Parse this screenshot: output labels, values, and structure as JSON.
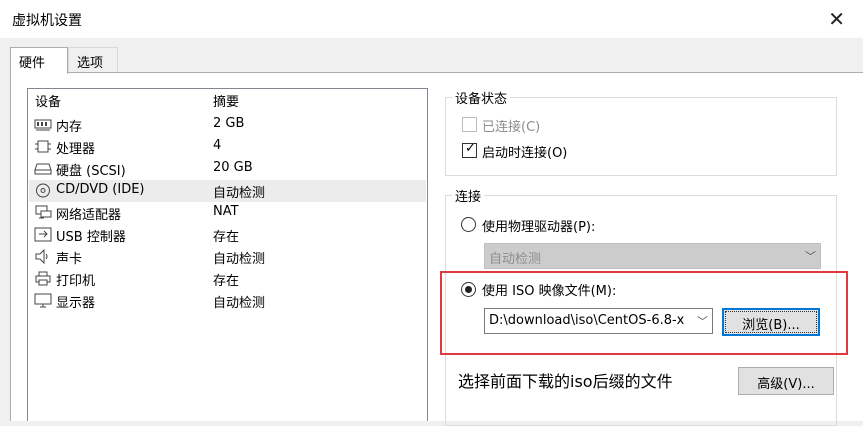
{
  "window": {
    "title": "虚拟机设置",
    "close_glyph": "✕"
  },
  "tabs": [
    {
      "label": "硬件"
    },
    {
      "label": "选项"
    }
  ],
  "device_list": {
    "headers": {
      "device": "设备",
      "summary": "摘要"
    },
    "rows": [
      {
        "name": "内存",
        "value": "2 GB",
        "icon": "memory-icon"
      },
      {
        "name": "处理器",
        "value": "4",
        "icon": "processor-icon"
      },
      {
        "name": "硬盘 (SCSI)",
        "value": "20 GB",
        "icon": "hard-disk-icon"
      },
      {
        "name": "CD/DVD (IDE)",
        "value": "自动检测",
        "icon": "cd-dvd-icon",
        "selected": true
      },
      {
        "name": "网络适配器",
        "value": "NAT",
        "icon": "network-adapter-icon"
      },
      {
        "name": "USB 控制器",
        "value": "存在",
        "icon": "usb-icon"
      },
      {
        "name": "声卡",
        "value": "自动检测",
        "icon": "speaker-icon"
      },
      {
        "name": "打印机",
        "value": "存在",
        "icon": "printer-icon"
      },
      {
        "name": "显示器",
        "value": "自动检测",
        "icon": "monitor-icon"
      }
    ]
  },
  "device_status": {
    "legend": "设备状态",
    "connected": {
      "label": "已连接(C)",
      "checked": false,
      "disabled": true
    },
    "connect_at_power_on": {
      "label": "启动时连接(O)",
      "checked": true
    }
  },
  "connection": {
    "legend": "连接",
    "physical_drive": {
      "label": "使用物理驱动器(P):",
      "selected": false
    },
    "physical_drive_select": {
      "value": "自动检测"
    },
    "iso_image": {
      "label": "使用 ISO 映像文件(M):",
      "selected": true
    },
    "iso_path": {
      "value": "D:\\download\\iso\\CentOS-6.8-x"
    },
    "browse_button": {
      "label": "浏览(B)..."
    },
    "advanced_button": {
      "label": "高级(V)..."
    }
  },
  "annotation": {
    "note": "选择前面下载的iso后缀的文件",
    "highlight_color": "#e0393e"
  },
  "colors": {
    "selection": "#ececec",
    "focus": "#0078d7"
  }
}
